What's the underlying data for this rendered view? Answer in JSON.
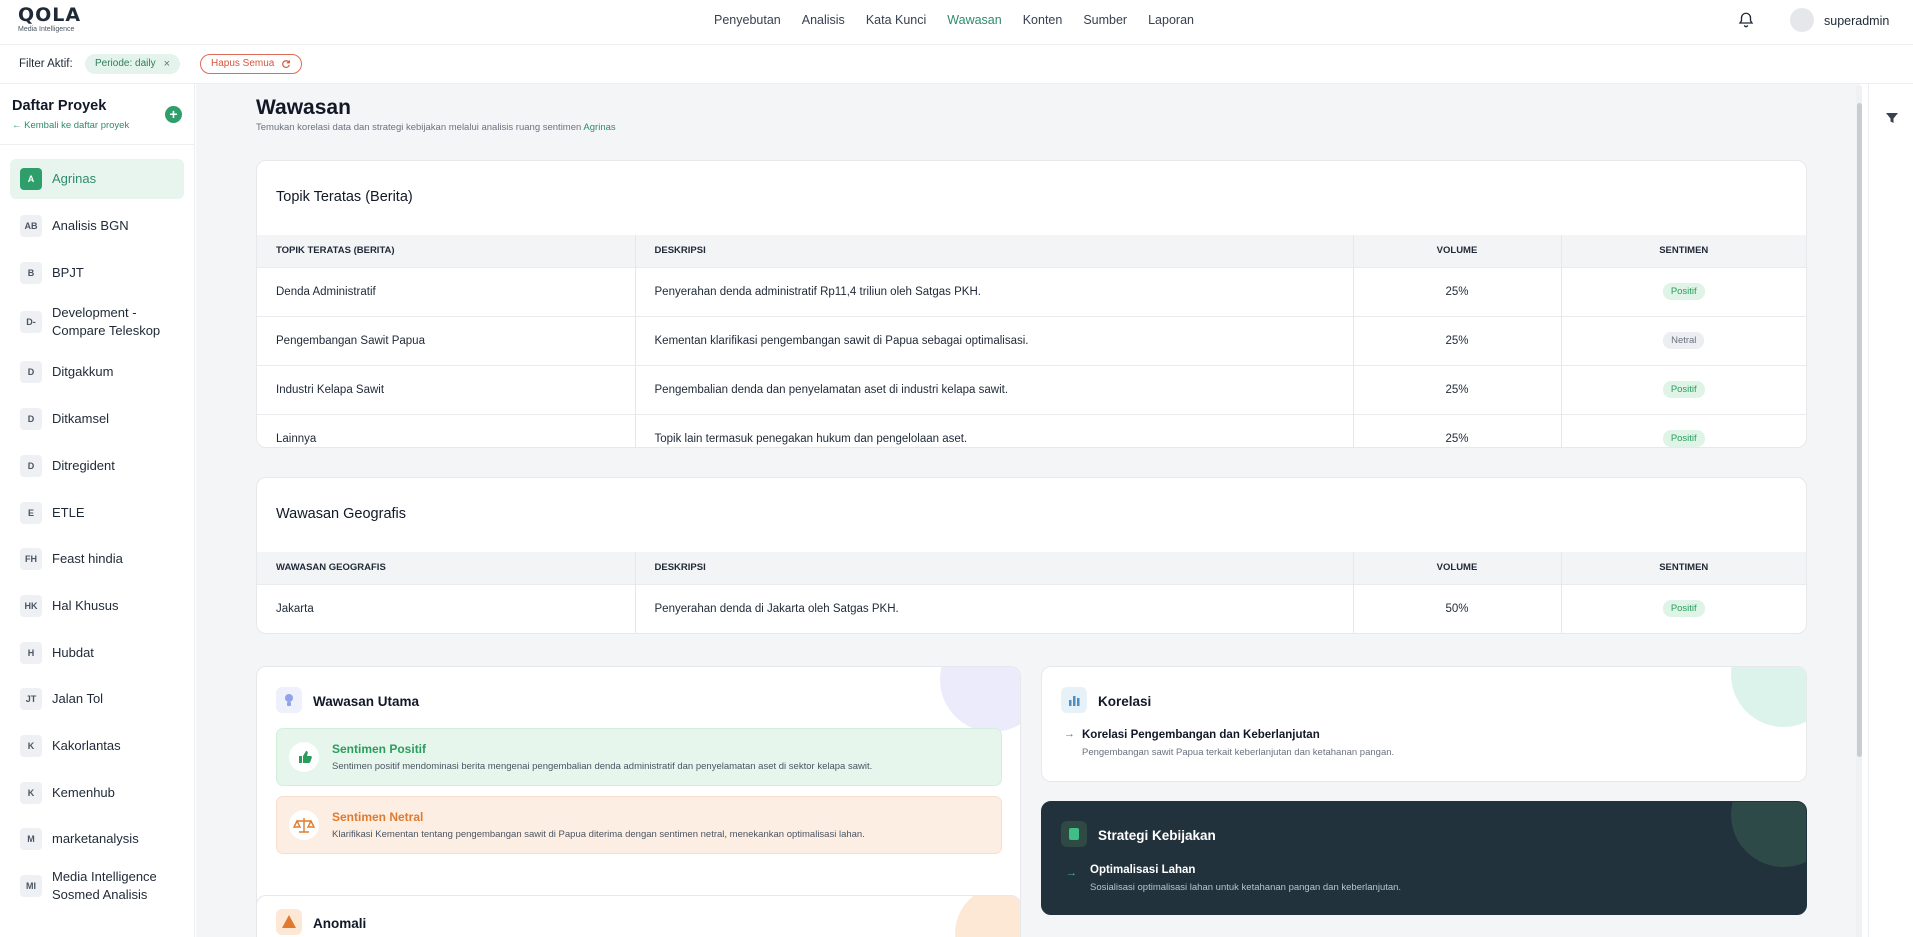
{
  "header": {
    "logo_text": "QOLA",
    "logo_sub": "Media Intelligence",
    "nav": [
      "Penyebutan",
      "Analisis",
      "Kata Kunci",
      "Wawasan",
      "Konten",
      "Sumber",
      "Laporan"
    ],
    "active_nav": "Wawasan",
    "username": "superadmin",
    "icons": {
      "bell": "bell-icon",
      "avatar": "user-avatar"
    }
  },
  "filter": {
    "label": "Filter Aktif:",
    "period_chip": "Periode: daily",
    "clear_label": "Hapus Semua"
  },
  "sidebar": {
    "title": "Daftar Proyek",
    "back_link": "← Kembali ke daftar proyek",
    "add_icon": "plus-circle-icon",
    "items": [
      {
        "badge": "A",
        "label": "Agrinas",
        "active": true
      },
      {
        "badge": "AB",
        "label": "Analisis BGN"
      },
      {
        "badge": "B",
        "label": "BPJT"
      },
      {
        "badge": "D-",
        "label": "Development - Compare Teleskop"
      },
      {
        "badge": "D",
        "label": "Ditgakkum"
      },
      {
        "badge": "D",
        "label": "Ditkamsel"
      },
      {
        "badge": "D",
        "label": "Ditregident"
      },
      {
        "badge": "E",
        "label": "ETLE"
      },
      {
        "badge": "FH",
        "label": "Feast hindia"
      },
      {
        "badge": "HK",
        "label": "Hal Khusus"
      },
      {
        "badge": "H",
        "label": "Hubdat"
      },
      {
        "badge": "JT",
        "label": "Jalan Tol"
      },
      {
        "badge": "K",
        "label": "Kakorlantas"
      },
      {
        "badge": "K",
        "label": "Kemenhub"
      },
      {
        "badge": "M",
        "label": "marketanalysis"
      },
      {
        "badge": "MI",
        "label": "Media Intelligence Sosmed Analisis"
      }
    ]
  },
  "page": {
    "title": "Wawasan",
    "subtitle": "Temukan korelasi data dan strategi kebijakan melalui analisis ruang sentimen",
    "subtitle_project": "Agrinas"
  },
  "topics": {
    "title": "Topik Teratas (Berita)",
    "headers": [
      "TOPIK TERATAS (BERITA)",
      "DESKRIPSI",
      "VOLUME",
      "SENTIMEN"
    ],
    "rows": [
      {
        "topic": "Denda Administratif",
        "desc": "Penyerahan denda administratif Rp11,4 triliun oleh Satgas PKH.",
        "volume": "25%",
        "sentiment": "Positif"
      },
      {
        "topic": "Pengembangan Sawit Papua",
        "desc": "Kementan klarifikasi pengembangan sawit di Papua sebagai optimalisasi.",
        "volume": "25%",
        "sentiment": "Netral"
      },
      {
        "topic": "Industri Kelapa Sawit",
        "desc": "Pengembalian denda dan penyelamatan aset di industri kelapa sawit.",
        "volume": "25%",
        "sentiment": "Positif"
      },
      {
        "topic": "Lainnya",
        "desc": "Topik lain termasuk penegakan hukum dan pengelolaan aset.",
        "volume": "25%",
        "sentiment": "Positif"
      }
    ]
  },
  "geo": {
    "title": "Wawasan Geografis",
    "headers": [
      "WAWASAN GEOGRAFIS",
      "DESKRIPSI",
      "VOLUME",
      "SENTIMEN"
    ],
    "rows": [
      {
        "topic": "Jakarta",
        "desc": "Penyerahan denda di Jakarta oleh Satgas PKH.",
        "volume": "50%",
        "sentiment": "Positif"
      }
    ]
  },
  "main_insight": {
    "title": "Wawasan Utama",
    "icon": "lightbulb-icon",
    "positive": {
      "title": "Sentimen Positif",
      "desc": "Sentimen positif mendominasi berita mengenai pengembalian denda administratif dan penyelamatan aset di sektor kelapa sawit.",
      "icon": "thumbs-up-icon"
    },
    "neutral": {
      "title": "Sentimen Netral",
      "desc": "Klarifikasi Kementan tentang pengembangan sawit di Papua diterima dengan sentimen netral, menekankan optimalisasi lahan.",
      "icon": "scale-icon"
    }
  },
  "correlation": {
    "title": "Korelasi",
    "icon": "bar-chart-icon",
    "item_title": "Korelasi Pengembangan dan Keberlanjutan",
    "item_desc": "Pengembangan sawit Papua terkait keberlanjutan dan ketahanan pangan."
  },
  "strategy": {
    "title": "Strategi Kebijakan",
    "icon": "policy-icon",
    "item_title": "Optimalisasi Lahan",
    "item_desc": "Sosialisasi optimalisasi lahan untuk ketahanan pangan dan keberlanjutan."
  },
  "anomaly": {
    "title": "Anomali",
    "icon": "warning-icon"
  },
  "colors": {
    "accent": "#2e8b6e",
    "positive": "#2a9d5c",
    "neutral_orange": "#e07a2e",
    "dark_card": "#22323c"
  }
}
